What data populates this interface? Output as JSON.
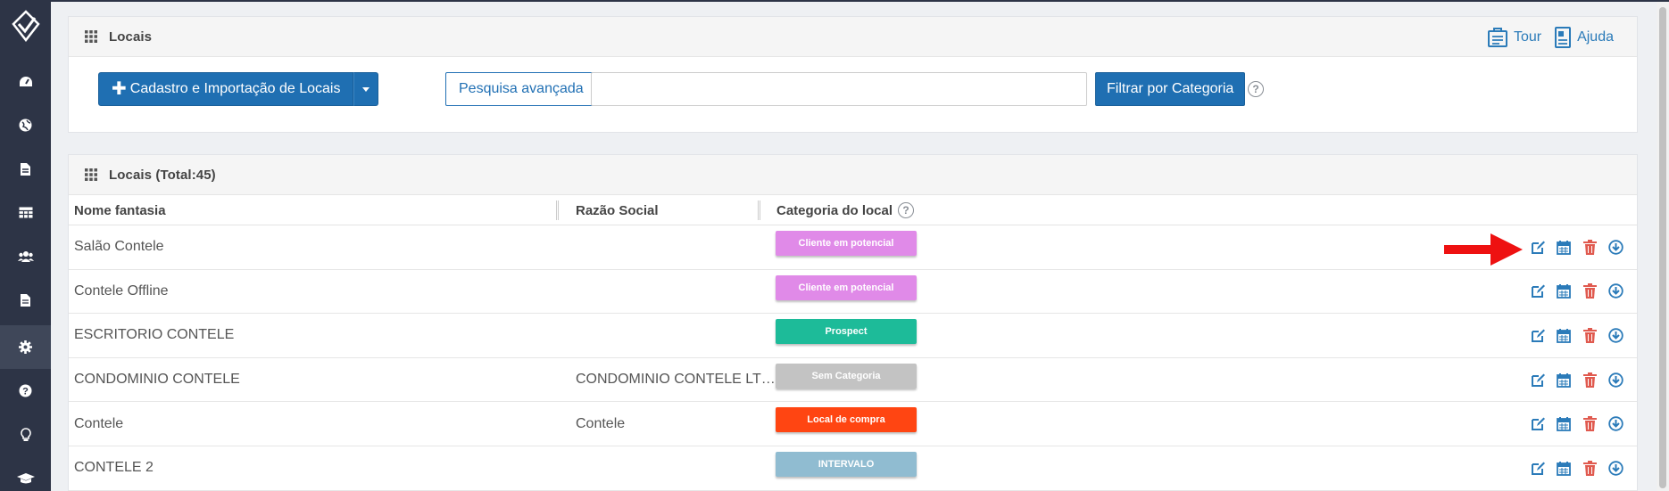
{
  "sidebar": {
    "items": [
      {
        "icon": "dashboard-icon"
      },
      {
        "icon": "globe-icon"
      },
      {
        "icon": "document-icon"
      },
      {
        "icon": "table-icon"
      },
      {
        "icon": "users-icon"
      },
      {
        "icon": "file-icon"
      },
      {
        "icon": "gear-icon",
        "active": true
      },
      {
        "icon": "question-icon"
      },
      {
        "icon": "lightbulb-icon"
      },
      {
        "icon": "graduation-cap-icon"
      }
    ]
  },
  "header_panel": {
    "title": "Locais",
    "tour_label": "Tour",
    "help_label": "Ajuda",
    "add_button_label": "Cadastro e Importação de Locais",
    "advanced_search_label": "Pesquisa avançada",
    "search_value": "",
    "filter_button_label": "Filtrar por Categoria"
  },
  "list_panel": {
    "title": "Locais (Total:45)",
    "columns": {
      "name": "Nome fantasia",
      "company": "Razão Social",
      "category": "Categoria do local"
    },
    "rows": [
      {
        "name": "Salão Contele",
        "company": "",
        "category": "Cliente em potencial",
        "color": "#e08ae8"
      },
      {
        "name": "Contele Offline",
        "company": "",
        "category": "Cliente em potencial",
        "color": "#e08ae8"
      },
      {
        "name": "ESCRITORIO CONTELE",
        "company": "",
        "category": "Prospect",
        "color": "#1dbb99"
      },
      {
        "name": "CONDOMINIO CONTELE",
        "company": "CONDOMINIO CONTELE LT…",
        "category": "Sem Categoria",
        "color": "#c3c3c3"
      },
      {
        "name": "Contele",
        "company": "Contele",
        "category": "Local de compra",
        "color": "#ff4512"
      },
      {
        "name": "CONTELE 2",
        "company": "",
        "category": "INTERVALO",
        "color": "#90bcd1"
      }
    ]
  },
  "colors": {
    "sidebar_bg": "#2d3446",
    "primary": "#1f6fb2",
    "link": "#2b7bb9",
    "delete": "#e05a4f",
    "arrow": "#ee1111"
  }
}
